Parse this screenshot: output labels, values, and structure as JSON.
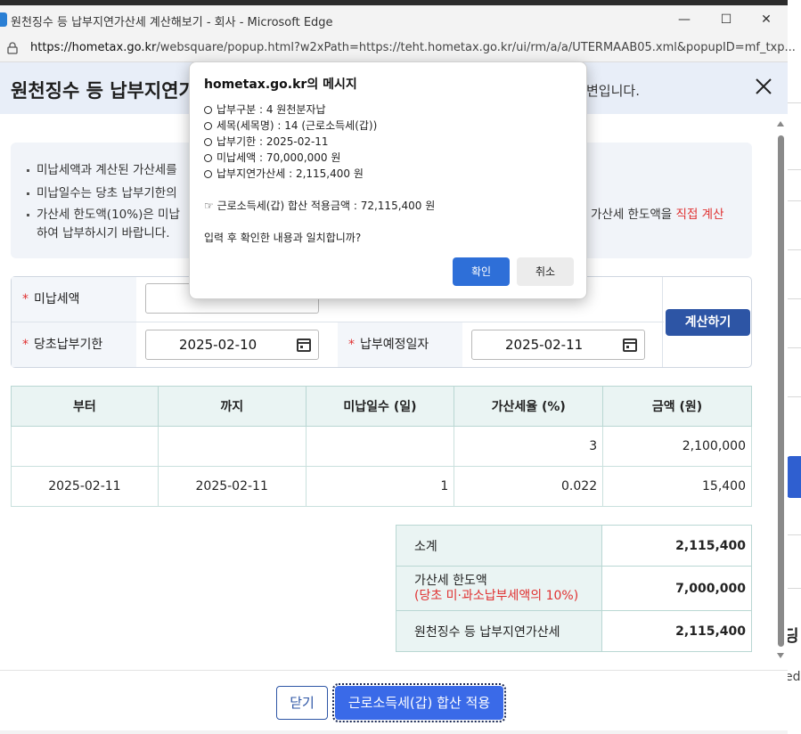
{
  "browser": {
    "window_title": "원천징수 등 납부지연가산세 계산해보기 - 회사 - Microsoft Edge",
    "url_domain": "https://hometax.go.kr",
    "url_rest": "/websquare/popup.html?w2xPath=https://teht.hometax.go.kr/ui/rm/a/a/UTERMAAB05.xml&popupID=mf_txp..."
  },
  "popup": {
    "title": "원천징수 등 납부지연가",
    "subtitle_tail": "변입니다.",
    "notice": {
      "line1": "미납세액과 계산된 가산세를",
      "line2": "미납일수는 당초 납부기한의",
      "line3": "가산세 한도액(10%)은 미납",
      "line3_tail_prefix": "가산세 한도액을 ",
      "line3_tail_red": "직접 계산",
      "line4": "하여 납부하시기 바랍니다."
    },
    "form": {
      "unpaid_label": "미납세액",
      "unpaid_value": "",
      "due_label": "당초납부기한",
      "due_value": "2025-02-10",
      "planned_label": "납부예정일자",
      "planned_value": "2025-02-11",
      "calc_button": "계산하기"
    },
    "table": {
      "headers": [
        "부터",
        "까지",
        "미납일수 (일)",
        "가산세율 (%)",
        "금액 (원)"
      ],
      "rows": [
        [
          "",
          "",
          "",
          "3",
          "2,100,000"
        ],
        [
          "2025-02-11",
          "2025-02-11",
          "1",
          "0.022",
          "15,400"
        ]
      ]
    },
    "summary": {
      "subtotal_label": "소계",
      "subtotal_value": "2,115,400",
      "limit_label": "가산세 한도액",
      "limit_note": "(당초 미·과소납부세액의 10%)",
      "limit_value": "7,000,000",
      "total_label": "원천징수 등 납부지연가산세",
      "total_value": "2,115,400"
    },
    "footer": {
      "close_button": "닫기",
      "apply_button": "근로소득세(갑) 합산 적용"
    }
  },
  "dialog": {
    "title": "hometax.go.kr의 메시지",
    "lines": [
      "납부구분 : 4 원천분자납",
      "세목(세목명) : 14 (근로소득세(갑))",
      "납부기한 : 2025-02-11",
      "미납세액 : 70,000,000 원",
      "납부지연가산세 : 2,115,400 원"
    ],
    "sum_line": "☞ 근로소득세(갑) 합산 적용금액 : 72,115,400 원",
    "question": "입력 후 확인한 내용과 일치합니까?",
    "ok_button": "확인",
    "cancel_button": "취소"
  },
  "background": {
    "glyph1": "딩",
    "glyph2": "ed."
  },
  "colors": {
    "accent_blue": "#3a6ae8",
    "calc_button": "#2d55a5",
    "warning_red": "#e03131",
    "table_header": "#eaf4f3"
  }
}
